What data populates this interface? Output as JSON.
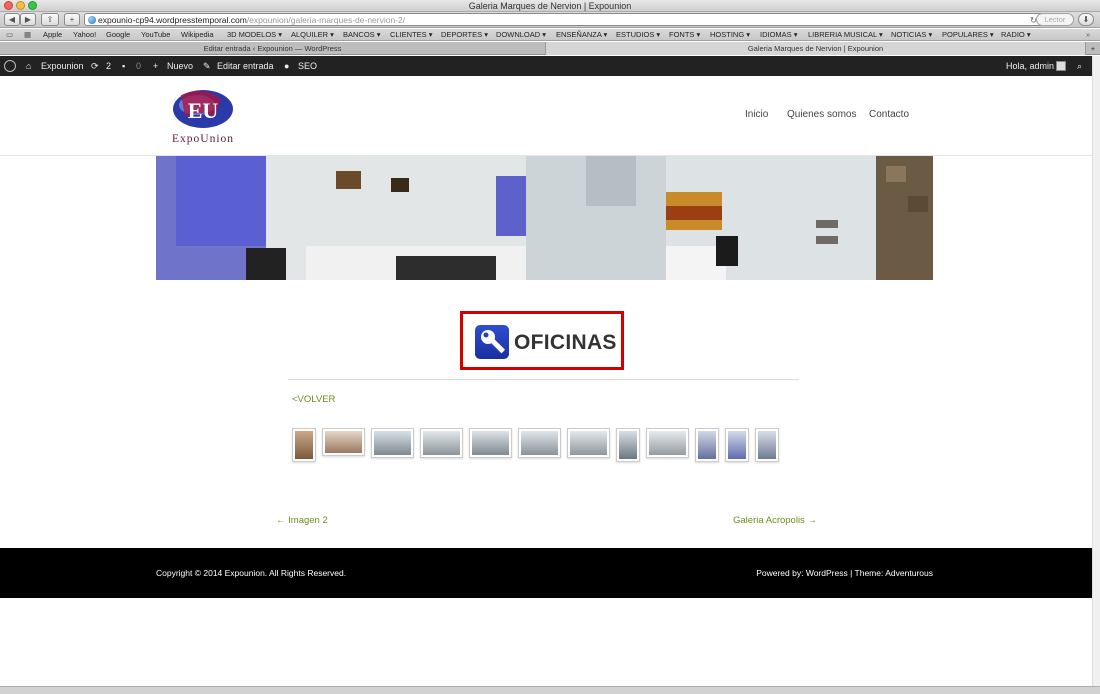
{
  "browser": {
    "window_title": "Galeria Marques de Nervion | Expounion",
    "url_host": "expounio-cp94.wordpresstemporal.com",
    "url_path": "/expounion/galeria-marques-de-nervion-2/",
    "reader_label": "Lector",
    "bookmarks": [
      "Apple",
      "Yahoo!",
      "Google",
      "YouTube",
      "Wikipedia",
      "3D MODELOS ▾",
      "ALQUILER ▾",
      "BANCOS ▾",
      "CLIENTES ▾",
      "DEPORTES ▾",
      "DOWNLOAD ▾",
      "ENSEÑANZA ▾",
      "ESTUDIOS ▾",
      "FONTS ▾",
      "HOSTING ▾",
      "IDIOMAS ▾",
      "LIBRERIA MUSICAL ▾",
      "NOTICIAS ▾",
      "POPULARES ▾",
      "RADIO ▾"
    ],
    "tabs": [
      "Editar entrada ‹ Expounion — WordPress",
      "Galeria Marques de Nervion | Expounion"
    ]
  },
  "adminbar": {
    "site_name": "Expounion",
    "updates_count": "2",
    "comments_count": "0",
    "new_label": "Nuevo",
    "edit_label": "Editar entrada",
    "seo_label": "SEO",
    "greeting": "Hola, admin"
  },
  "site": {
    "logo_text": "ExpoUnion",
    "nav": [
      "Inicio",
      "Quienes somos",
      "Contacto"
    ]
  },
  "content": {
    "badge_label": "OFICINAS",
    "back_link": "<VOLVER",
    "prev_link": "← Imagen 2",
    "next_link": "Galeria Acropolis →"
  },
  "footer": {
    "copyright": "Copyright © 2014 Expounion. All Rights Reserved.",
    "powered_prefix": "Powered by:",
    "powered_wp": "WordPress",
    "sep": "|",
    "theme_prefix": "Theme:",
    "theme_name": "Adventurous"
  },
  "colors": {
    "link_green": "#6a8f1f",
    "badge_border": "#d40000",
    "adminbar_bg": "#222222",
    "footer_bg": "#000000"
  }
}
